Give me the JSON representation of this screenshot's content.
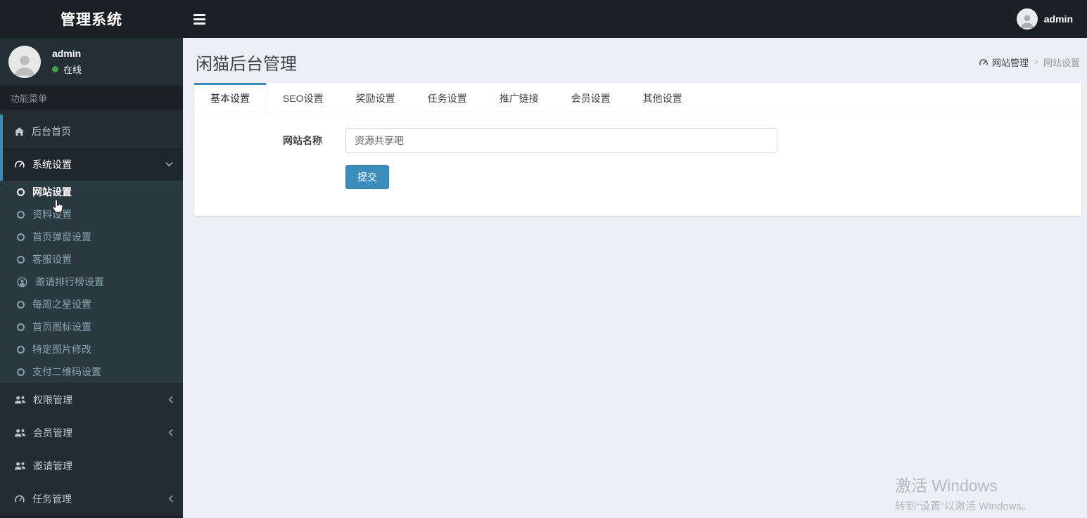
{
  "app": {
    "title": "管理系统"
  },
  "topbar": {
    "username": "admin"
  },
  "sidebar": {
    "user": {
      "name": "admin",
      "status": "在线"
    },
    "section_label": "功能菜单",
    "menu": [
      {
        "label": "后台首页"
      },
      {
        "label": "系统设置"
      },
      {
        "label": "权限管理"
      },
      {
        "label": "会员管理"
      },
      {
        "label": "邀请管理"
      },
      {
        "label": "任务管理"
      }
    ],
    "submenu": [
      {
        "label": "网站设置"
      },
      {
        "label": "资料设置"
      },
      {
        "label": "首页弹窗设置"
      },
      {
        "label": "客服设置"
      },
      {
        "label": "邀请排行榜设置"
      },
      {
        "label": "每周之星设置"
      },
      {
        "label": "首页图标设置"
      },
      {
        "label": "特定图片修改"
      },
      {
        "label": "支付二维码设置"
      }
    ]
  },
  "main": {
    "page_title": "闲猫后台管理",
    "breadcrumb": {
      "parent": "网站管理",
      "separator": ">",
      "current": "网站设置"
    },
    "tabs": [
      {
        "label": "基本设置"
      },
      {
        "label": "SEO设置"
      },
      {
        "label": "奖励设置"
      },
      {
        "label": "任务设置"
      },
      {
        "label": "推广链接"
      },
      {
        "label": "会员设置"
      },
      {
        "label": "其他设置"
      }
    ],
    "form": {
      "site_name_label": "网站名称",
      "site_name_value": "资源共享吧",
      "submit_label": "提交"
    }
  },
  "watermark": {
    "line1": "激活 Windows",
    "line2": "转到“设置”以激活 Windows。"
  },
  "colors": {
    "accent": "#3c8dbc",
    "topbar_bg": "#1a2125",
    "sidebar_bg": "#222c31",
    "submenu_bg": "#2b3940",
    "content_bg": "#ecf0f5",
    "online_green": "#3fa142"
  }
}
